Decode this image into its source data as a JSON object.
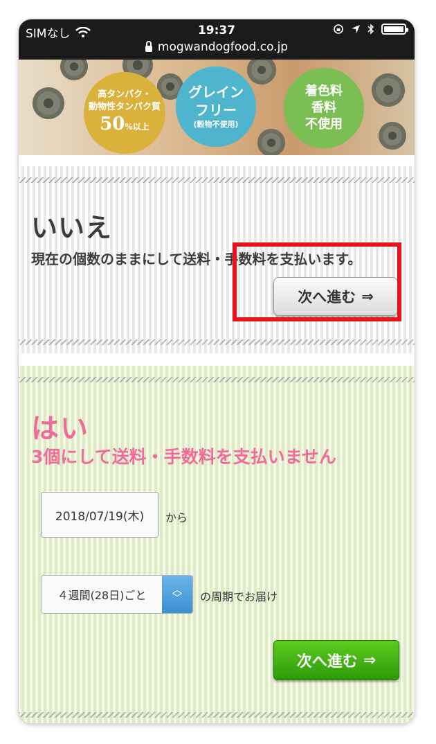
{
  "status_bar": {
    "carrier": "SIMなし",
    "time": "19:37",
    "url": "mogwandogfood.co.jp"
  },
  "banner": {
    "badge1": {
      "line1": "高タンパク・",
      "line2": "動物性タンパク質",
      "percent": "50",
      "percent_suffix": "%以上"
    },
    "badge2": {
      "line1": "グレイン",
      "line2": "フリー",
      "line3": "(穀物不使用)"
    },
    "badge3": {
      "line1": "着色料",
      "line2": "香料",
      "line3": "不使用"
    }
  },
  "no_option": {
    "title": "いいえ",
    "subtitle": "現在の個数のままにして送料・手数料を支払います。",
    "next_button": "次へ進む",
    "arrow": "⇒"
  },
  "yes_option": {
    "title": "はい",
    "subtitle": "3個にして送料・手数料を支払いません",
    "date_value": "2018/07/19(木)",
    "date_suffix": "から",
    "interval_value": "４週間(28日)ごと",
    "interval_suffix": "の周期でお届け",
    "next_button": "次へ進む",
    "arrow": "⇒"
  },
  "colors": {
    "highlight": "#e8131b",
    "pink": "#f06a9a",
    "green_button": "#3fae12"
  }
}
